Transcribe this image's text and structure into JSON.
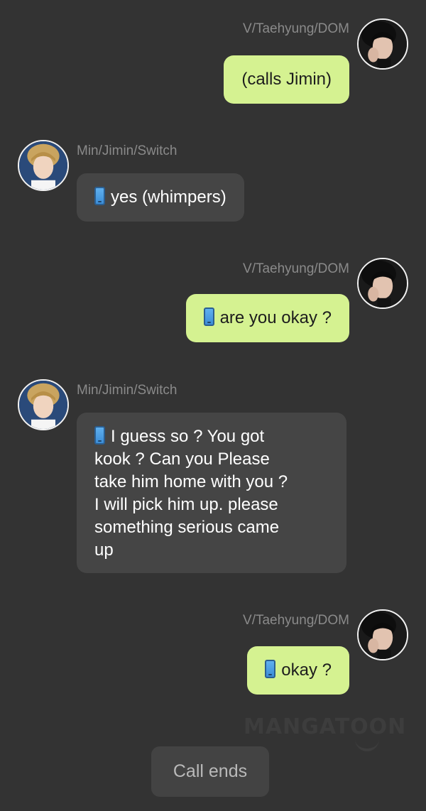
{
  "colors": {
    "background": "#333333",
    "sender_bubble": "#d5f291",
    "receiver_bubble": "#454545",
    "name_text": "#8a8a8a"
  },
  "icons": {
    "phone": "mobile-phone-icon"
  },
  "messages": [
    {
      "side": "right",
      "name": "V/Taehyung/DOM",
      "text": "(calls Jimin)",
      "phone_icon": false
    },
    {
      "side": "left",
      "name": "Min/Jimin/Switch",
      "text": "yes (whimpers)",
      "phone_icon": true
    },
    {
      "side": "right",
      "name": "V/Taehyung/DOM",
      "text": "are you okay ?",
      "phone_icon": true
    },
    {
      "side": "left",
      "name": "Min/Jimin/Switch",
      "lines": [
        "I guess so ? You got",
        "kook ? Can you Please",
        "take him home with you ?",
        "I will pick him up. please",
        "something serious came",
        "up"
      ],
      "phone_icon": true
    },
    {
      "side": "right",
      "name": "V/Taehyung/DOM",
      "text": "okay ?",
      "phone_icon": true
    }
  ],
  "watermark": "MANGATOON",
  "footer": {
    "call_ends_label": "Call ends"
  }
}
